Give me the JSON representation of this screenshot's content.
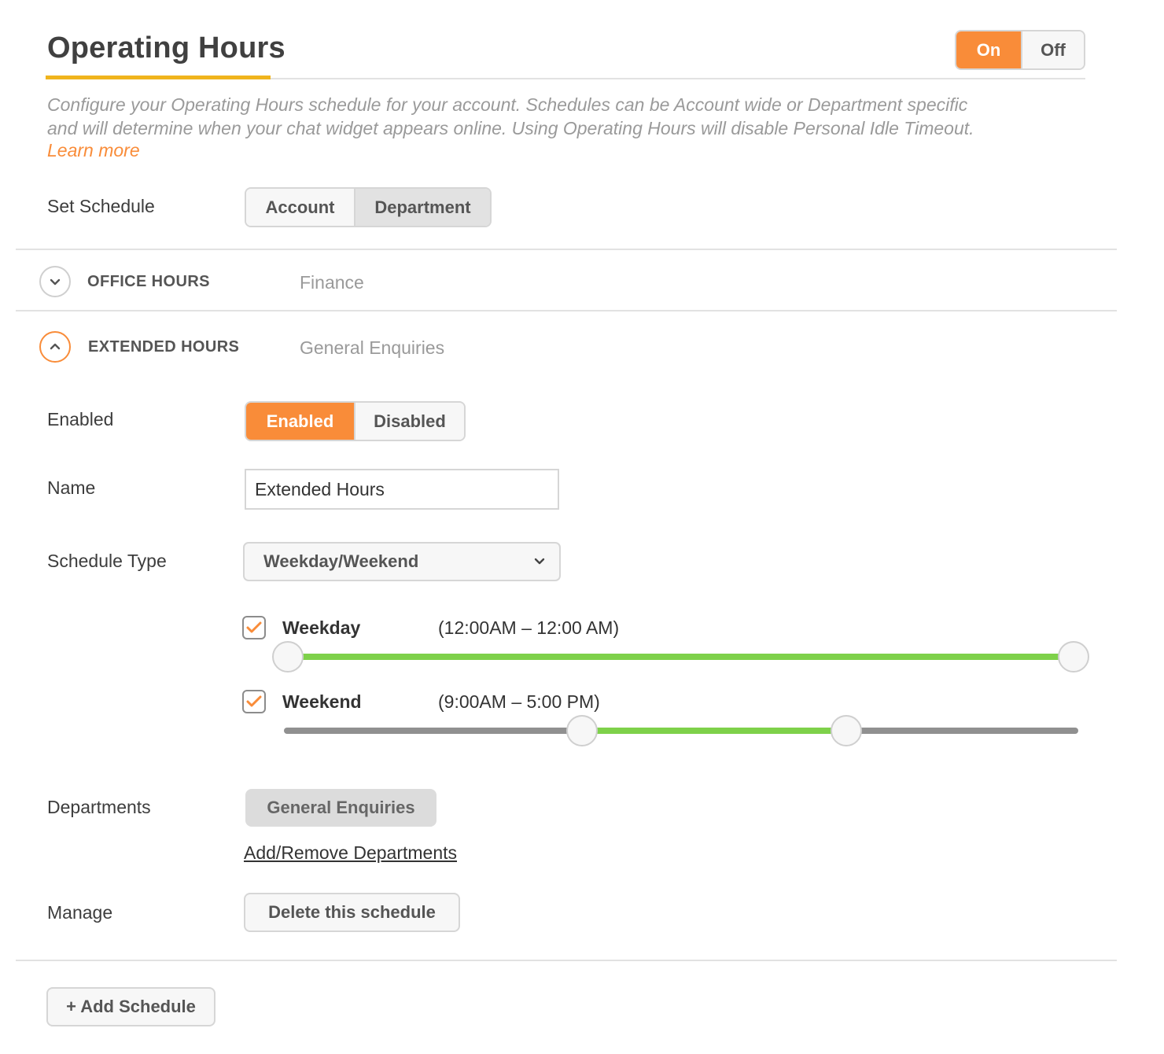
{
  "header": {
    "title": "Operating Hours",
    "toggle": {
      "on_label": "On",
      "off_label": "Off",
      "selected": "On"
    }
  },
  "description": {
    "line1": "Configure your Operating Hours schedule for your account. Schedules can be Account wide or Department specific",
    "line2": "and will determine when your chat widget appears online. Using Operating Hours will disable Personal Idle Timeout.",
    "learn_more": "Learn more"
  },
  "set_schedule": {
    "label": "Set Schedule",
    "options": [
      "Account",
      "Department"
    ],
    "selected": "Department"
  },
  "schedules": [
    {
      "title": "OFFICE HOURS",
      "department": "Finance",
      "expanded": false
    },
    {
      "title": "EXTENDED HOURS",
      "department": "General Enquiries",
      "expanded": true
    }
  ],
  "form": {
    "enabled": {
      "label": "Enabled",
      "options": [
        "Enabled",
        "Disabled"
      ],
      "selected": "Enabled"
    },
    "name": {
      "label": "Name",
      "value": "Extended Hours"
    },
    "schedule_type": {
      "label": "Schedule Type",
      "value": "Weekday/Weekend"
    },
    "days": [
      {
        "label": "Weekday",
        "range": "(12:00AM – 12:00 AM)",
        "checked": true,
        "start_fraction": 0.0,
        "end_fraction": 1.0
      },
      {
        "label": "Weekend",
        "range": "(9:00AM – 5:00 PM)",
        "checked": true,
        "start_fraction": 0.375,
        "end_fraction": 0.7083
      }
    ],
    "departments": {
      "label": "Departments",
      "chip": "General Enquiries",
      "link": "Add/Remove Departments"
    },
    "manage": {
      "label": "Manage",
      "delete_button": "Delete this schedule"
    }
  },
  "add_schedule_button": "+ Add Schedule",
  "colors": {
    "accent": "#f98c39",
    "underline": "#f0b41d",
    "slider_fill": "#7ed14a",
    "slider_track": "#909090"
  },
  "icons": {
    "collapsed": "chevron-down-icon",
    "expanded": "chevron-up-icon",
    "check": "checkmark-icon",
    "dropdown": "caret-down-icon"
  }
}
